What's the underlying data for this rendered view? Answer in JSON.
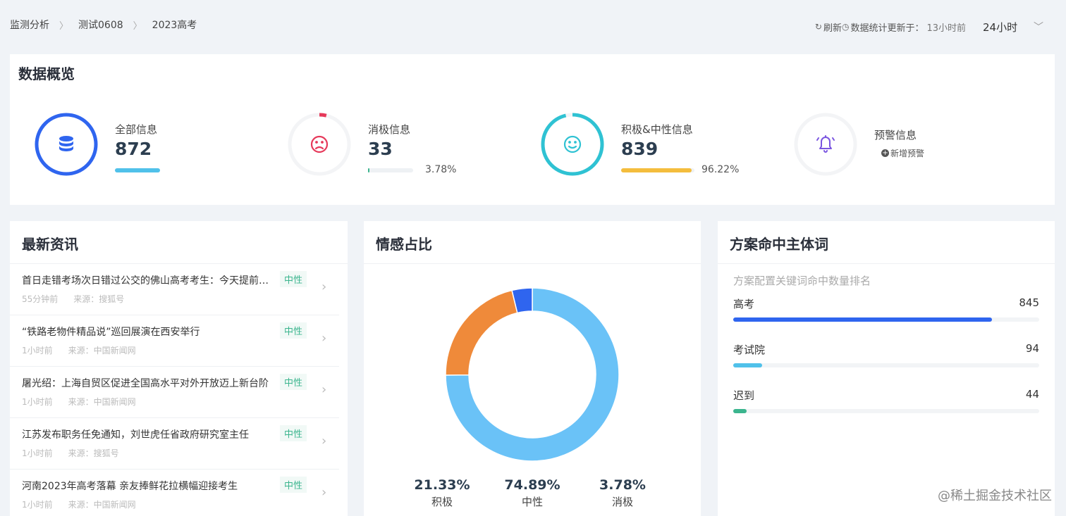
{
  "breadcrumb": [
    "监测分析",
    "测试0608",
    "2023高考"
  ],
  "header": {
    "refresh_label": "刷新",
    "updated_label": "数据统计更新于：",
    "updated_time": "13小时前",
    "range_selected": "24小时"
  },
  "overview": {
    "title": "数据概览",
    "all": {
      "label": "全部信息",
      "value": "872",
      "color": "#2f65ef",
      "bar_color": "#50c1ea"
    },
    "negative": {
      "label": "消极信息",
      "value": "33",
      "percent": "3.78%",
      "fraction": 0.0378,
      "color": "#e6395a",
      "bar_color": "#3bb58e"
    },
    "positive": {
      "label": "积极&中性信息",
      "value": "839",
      "percent": "96.22%",
      "fraction": 0.9622,
      "color": "#2fc2d3",
      "bar_color": "#f4bd3d"
    },
    "alert": {
      "label": "预警信息",
      "add_label": "新增预警",
      "color": "#7a55e0"
    }
  },
  "news": {
    "title": "最新资讯",
    "items": [
      {
        "title": "首日走错考场次日错过公交的佛山高考考生：今天提前出门",
        "time": "55分钟前",
        "source": "来源：搜狐号",
        "tag": "中性"
      },
      {
        "title": "“铁路老物件精品说”巡回展演在西安举行",
        "time": "1小时前",
        "source": "来源：中国新闻网",
        "tag": "中性"
      },
      {
        "title": "屠光绍：上海自贸区促进全国高水平对外开放迈上新台阶",
        "time": "1小时前",
        "source": "来源：中国新闻网",
        "tag": "中性"
      },
      {
        "title": "江苏发布职务任免通知，刘世虎任省政府研究室主任",
        "time": "1小时前",
        "source": "来源：搜狐号",
        "tag": "中性"
      },
      {
        "title": "河南2023年高考落幕 亲友捧鲜花拉横幅迎接考生",
        "time": "1小时前",
        "source": "来源：中国新闻网",
        "tag": "中性"
      }
    ]
  },
  "sentiment": {
    "title": "情感占比",
    "chart_data": {
      "type": "pie",
      "categories": [
        "积极",
        "中性",
        "消极"
      ],
      "values": [
        21.33,
        74.89,
        3.78
      ],
      "labels": [
        "21.33%",
        "74.89%",
        "3.78%"
      ],
      "colors": [
        "#ef8a3a",
        "#6ac2f7",
        "#2f65ef"
      ]
    }
  },
  "subjects": {
    "title": "方案命中主体词",
    "subtitle": "方案配置关键词命中数量排名",
    "items": [
      {
        "name": "高考",
        "value": 845,
        "value_label": "845",
        "color": "#2f65ef"
      },
      {
        "name": "考试院",
        "value": 94,
        "value_label": "94",
        "color": "#50c1ea"
      },
      {
        "name": "迟到",
        "value": 44,
        "value_label": "44",
        "color": "#3bb58e"
      }
    ]
  },
  "watermark": "@稀土掘金技术社区"
}
